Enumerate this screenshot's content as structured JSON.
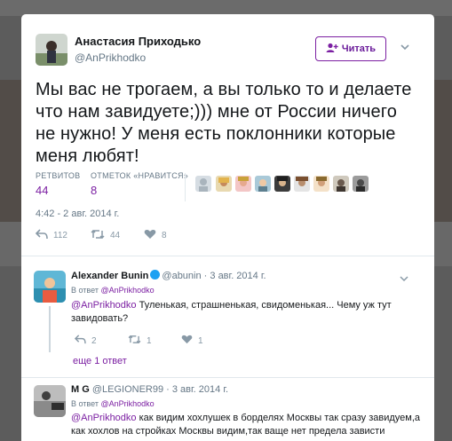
{
  "main_tweet": {
    "author_name": "Анастасия Приходько",
    "author_handle": "@AnPrikhodko",
    "follow_label": "Читать",
    "text": "Мы вас не трогаем, а вы только то и делаете что нам завидуете;))) мне от России ничего не нужно! У меня есть поклонники которые меня любят!",
    "retweets_label": "РЕТВИТОВ",
    "retweets_value": "44",
    "likes_label": "ОТМЕТОК «НРАВИТСЯ»",
    "likes_value": "8",
    "timestamp": "4:42 - 2 авг. 2014 г.",
    "actions": {
      "reply_count": "112",
      "retweet_count": "44",
      "like_count": "8"
    }
  },
  "replies": [
    {
      "author_name": "Alexander Bunin",
      "author_handle": "@abunin",
      "date": "· 3 авг. 2014 г.",
      "in_reply_prefix": "В ответ",
      "in_reply_to": "@AnPrikhodko",
      "mention": "@AnPrikhodko",
      "text": " Туленькая, страшненькая, свидоменькая... Чему уж тут завидовать?",
      "actions": {
        "reply_count": "2",
        "retweet_count": "1",
        "like_count": "1"
      },
      "more_replies": "еще 1 ответ"
    },
    {
      "author_name": "M G",
      "author_handle": "@LEGIONER99",
      "date": "· 3 авг. 2014 г.",
      "in_reply_prefix": "В ответ",
      "in_reply_to": "@AnPrikhodko",
      "mention": "@AnPrikhodko",
      "text": " как видим хохлушек в борделях Москвы так сразу завидуем,а как хохлов на стройках Москвы видим,так ваще нет предела зависти"
    }
  ],
  "colors": {
    "accent": "#7b1fa2",
    "muted": "#657786",
    "verified": "#1da1f2"
  }
}
